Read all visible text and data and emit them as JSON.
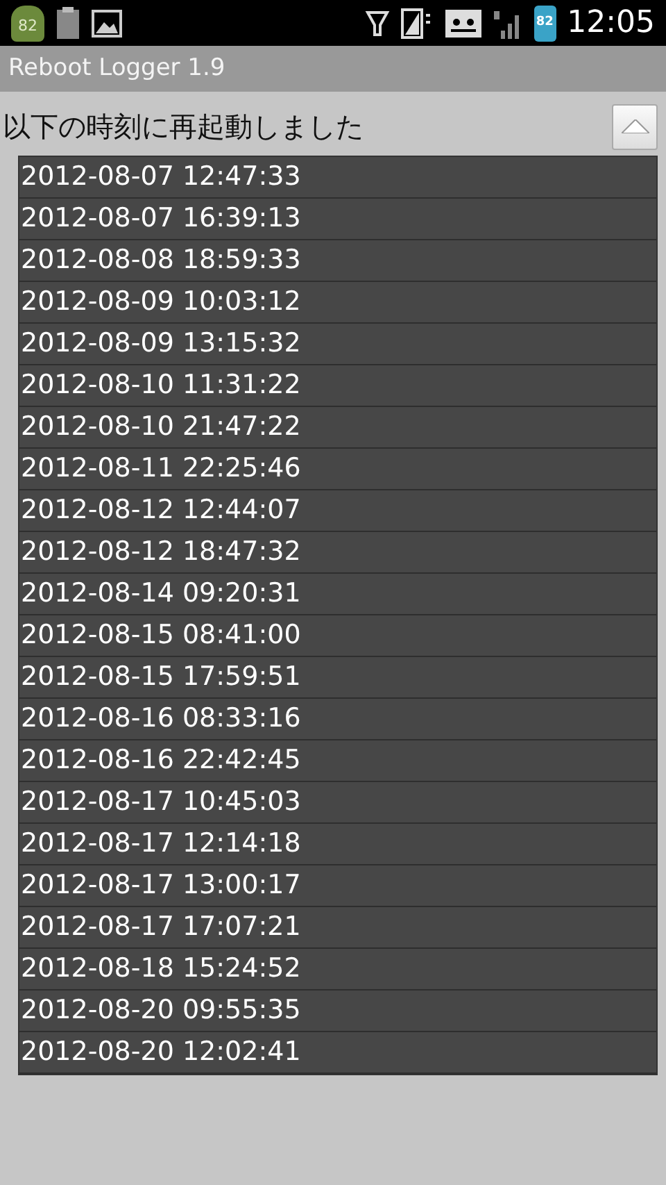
{
  "status_bar": {
    "notification_badge": "82",
    "battery_level_text": "82",
    "time": "12:05"
  },
  "title_bar": {
    "title": "Reboot Logger 1.9"
  },
  "heading": "以下の時刻に再起動しました",
  "reboots": [
    "2012-08-07 12:47:33",
    "2012-08-07 16:39:13",
    "2012-08-08 18:59:33",
    "2012-08-09 10:03:12",
    "2012-08-09 13:15:32",
    "2012-08-10 11:31:22",
    "2012-08-10 21:47:22",
    "2012-08-11 22:25:46",
    "2012-08-12 12:44:07",
    "2012-08-12 18:47:32",
    "2012-08-14 09:20:31",
    "2012-08-15 08:41:00",
    "2012-08-15 17:59:51",
    "2012-08-16 08:33:16",
    "2012-08-16 22:42:45",
    "2012-08-17 10:45:03",
    "2012-08-17 12:14:18",
    "2012-08-17 13:00:17",
    "2012-08-17 17:07:21",
    "2012-08-18 15:24:52",
    "2012-08-20 09:55:35",
    "2012-08-20 12:02:41"
  ]
}
